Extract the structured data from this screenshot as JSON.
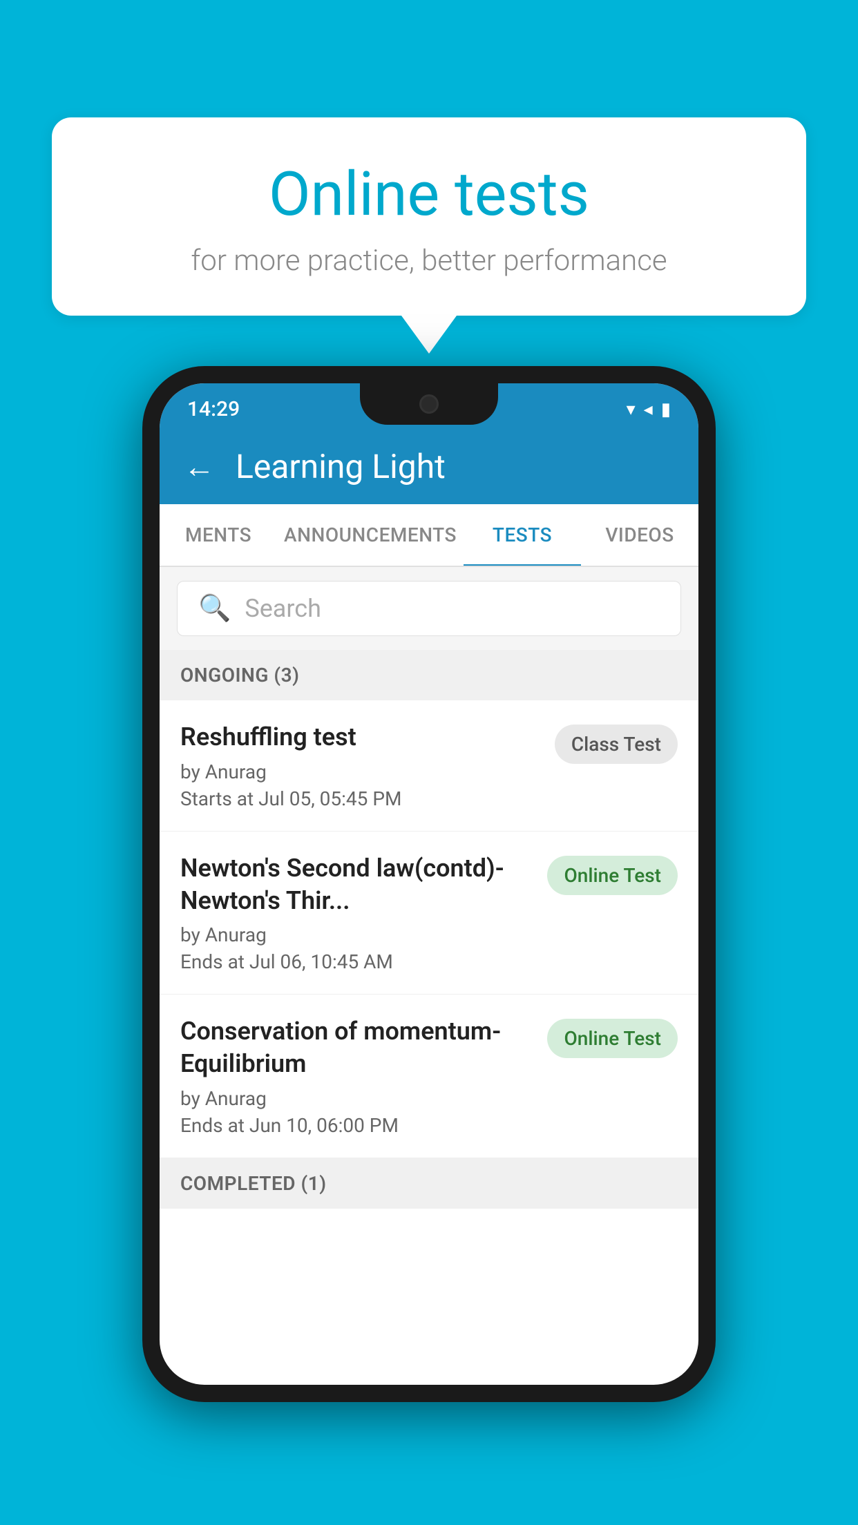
{
  "background_color": "#00b4d8",
  "speech_bubble": {
    "title": "Online tests",
    "subtitle": "for more practice, better performance"
  },
  "phone": {
    "status_bar": {
      "time": "14:29",
      "wifi": "▼",
      "signal": "▲",
      "battery": "▮"
    },
    "app_bar": {
      "title": "Learning Light",
      "back_label": "←"
    },
    "tabs": [
      {
        "label": "MENTS",
        "active": false
      },
      {
        "label": "ANNOUNCEMENTS",
        "active": false
      },
      {
        "label": "TESTS",
        "active": true
      },
      {
        "label": "VIDEOS",
        "active": false
      }
    ],
    "search": {
      "placeholder": "Search"
    },
    "ongoing_section": {
      "header": "ONGOING (3)",
      "tests": [
        {
          "title": "Reshuffling test",
          "author": "by Anurag",
          "time": "Starts at  Jul 05, 05:45 PM",
          "badge": "Class Test",
          "badge_type": "class"
        },
        {
          "title": "Newton's Second law(contd)-Newton's Thir...",
          "author": "by Anurag",
          "time": "Ends at  Jul 06, 10:45 AM",
          "badge": "Online Test",
          "badge_type": "online"
        },
        {
          "title": "Conservation of momentum-Equilibrium",
          "author": "by Anurag",
          "time": "Ends at  Jun 10, 06:00 PM",
          "badge": "Online Test",
          "badge_type": "online"
        }
      ]
    },
    "completed_section": {
      "header": "COMPLETED (1)"
    }
  }
}
